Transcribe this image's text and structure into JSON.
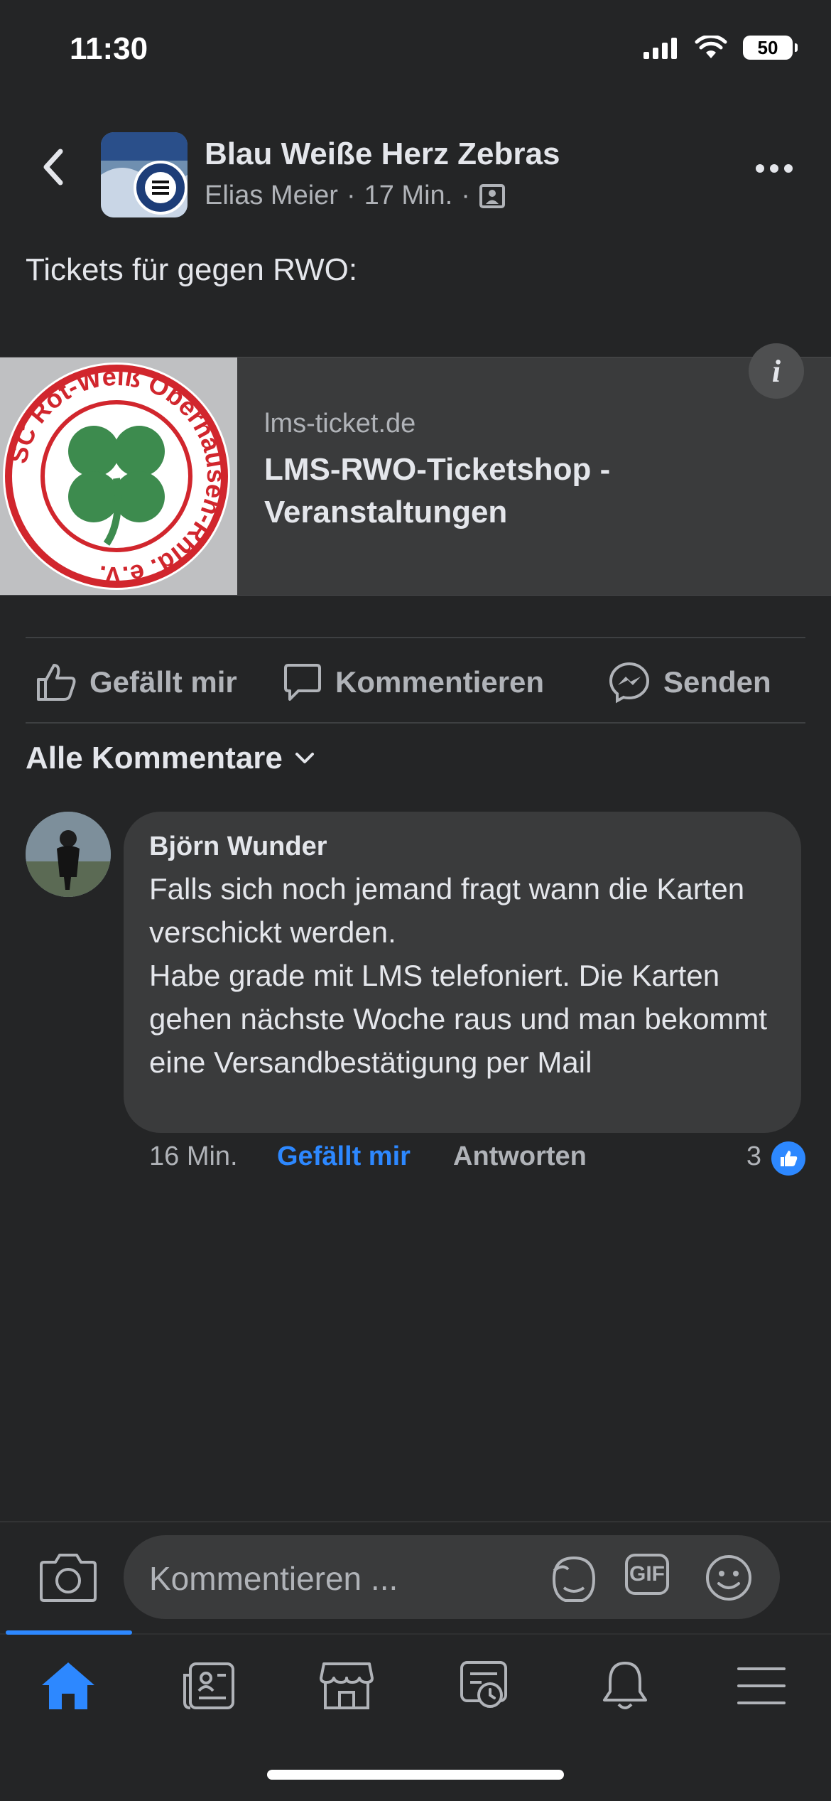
{
  "status_bar": {
    "time": "11:30",
    "battery": "50"
  },
  "header": {
    "group_name": "Blau Weiße Herz Zebras",
    "author": "Elias Meier",
    "time": "17 Min.",
    "separator": "·",
    "privacy_icon": "group-members-icon"
  },
  "post": {
    "text": "Tickets für gegen RWO:",
    "link": {
      "domain": "lms-ticket.de",
      "title": "LMS-RWO-Ticketshop - Veranstaltungen",
      "thumb_text": "SC Rot-Weiß Oberhausen-Rhld. e.V.",
      "info": "i"
    }
  },
  "actions": {
    "like": "Gefällt mir",
    "comment": "Kommentieren",
    "send": "Senden"
  },
  "comments_filter": "Alle Kommentare",
  "comments": [
    {
      "author": "Björn Wunder",
      "text": "Falls sich noch jemand fragt wann die Karten verschickt werden.\nHabe grade mit LMS telefoniert. Die Karten gehen nächste Woche raus und man bekommt eine Versandbestätigung per Mail",
      "time": "16 Min.",
      "like_label": "Gefällt mir",
      "reply_label": "Antworten",
      "like_count": "3"
    }
  ],
  "composer": {
    "placeholder": "Kommentieren ...",
    "gif": "GIF"
  },
  "tabs": [
    "home-icon",
    "news-icon",
    "marketplace-icon",
    "groups-activity-icon",
    "notifications-icon",
    "menu-icon"
  ],
  "colors": {
    "background": "#242526",
    "accent": "#2d88ff",
    "bubble": "#3a3b3c",
    "secondary_text": "#b0b3b8"
  }
}
